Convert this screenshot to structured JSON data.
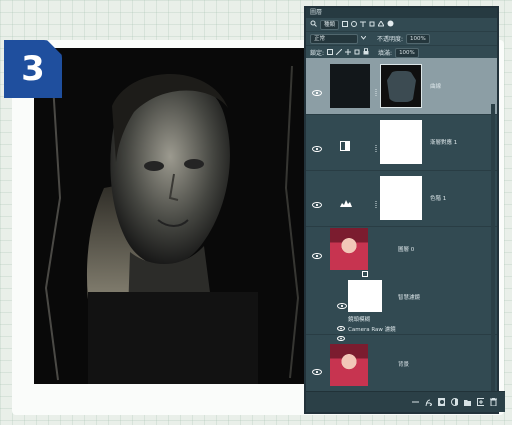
{
  "step": {
    "number": "3"
  },
  "panel": {
    "title": "圖層",
    "filter_kind": "種類",
    "blend_mode": "正常",
    "opacity_label": "不透明度:",
    "opacity_value": "100%",
    "lock_label": "鎖定:",
    "fill_label": "填滿:",
    "fill_value": "100%"
  },
  "layers": [
    {
      "name": "曲線",
      "type": "adjustment-curves",
      "selected": true
    },
    {
      "name": "漸層對應 1",
      "type": "adjustment-gradient-map",
      "selected": false
    },
    {
      "name": "色階 1",
      "type": "adjustment-levels",
      "selected": false
    },
    {
      "name": "圖層 0",
      "type": "smart-object",
      "selected": false
    },
    {
      "name": "智慧濾鏡",
      "type": "smart-filter-mask",
      "selected": false
    },
    {
      "name": "鏡頭模糊",
      "type": "filter",
      "selected": false
    },
    {
      "name": "Camera Raw 濾鏡",
      "type": "filter",
      "selected": false
    },
    {
      "name": "背景",
      "type": "background",
      "selected": false
    }
  ],
  "icons": {
    "filter": "search-icon",
    "visibility": "eye-icon",
    "link": "chain-icon",
    "footer": [
      "link-layers-icon",
      "fx-icon",
      "mask-icon",
      "adjustment-icon",
      "folder-icon",
      "new-layer-icon",
      "trash-icon"
    ]
  },
  "colors": {
    "panel_bg": "#324a52",
    "selected_layer": "#8c9ea5",
    "badge": "#1f4f9e"
  }
}
